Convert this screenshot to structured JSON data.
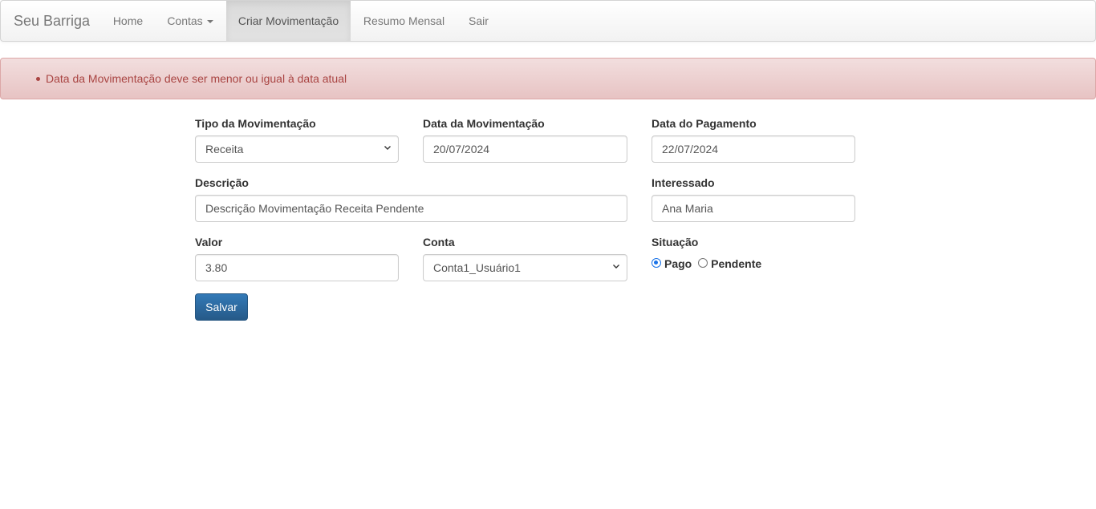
{
  "nav": {
    "brand": "Seu Barriga",
    "items": [
      {
        "label": "Home"
      },
      {
        "label": "Contas"
      },
      {
        "label": "Criar Movimentação"
      },
      {
        "label": "Resumo Mensal"
      },
      {
        "label": "Sair"
      }
    ]
  },
  "alert": {
    "messages": [
      "Data da Movimentação deve ser menor ou igual à data atual"
    ]
  },
  "form": {
    "tipo": {
      "label": "Tipo da Movimentação",
      "value": "Receita"
    },
    "data_movimentacao": {
      "label": "Data da Movimentação",
      "value": "20/07/2024"
    },
    "data_pagamento": {
      "label": "Data do Pagamento",
      "value": "22/07/2024"
    },
    "descricao": {
      "label": "Descrição",
      "value": "Descrição Movimentação Receita Pendente"
    },
    "interessado": {
      "label": "Interessado",
      "value": "Ana Maria"
    },
    "valor": {
      "label": "Valor",
      "value": "3.80"
    },
    "conta": {
      "label": "Conta",
      "value": "Conta1_Usuário1"
    },
    "situacao": {
      "label": "Situação",
      "options": [
        {
          "label": "Pago",
          "checked": true
        },
        {
          "label": "Pendente",
          "checked": false
        }
      ]
    },
    "submit_label": "Salvar"
  }
}
